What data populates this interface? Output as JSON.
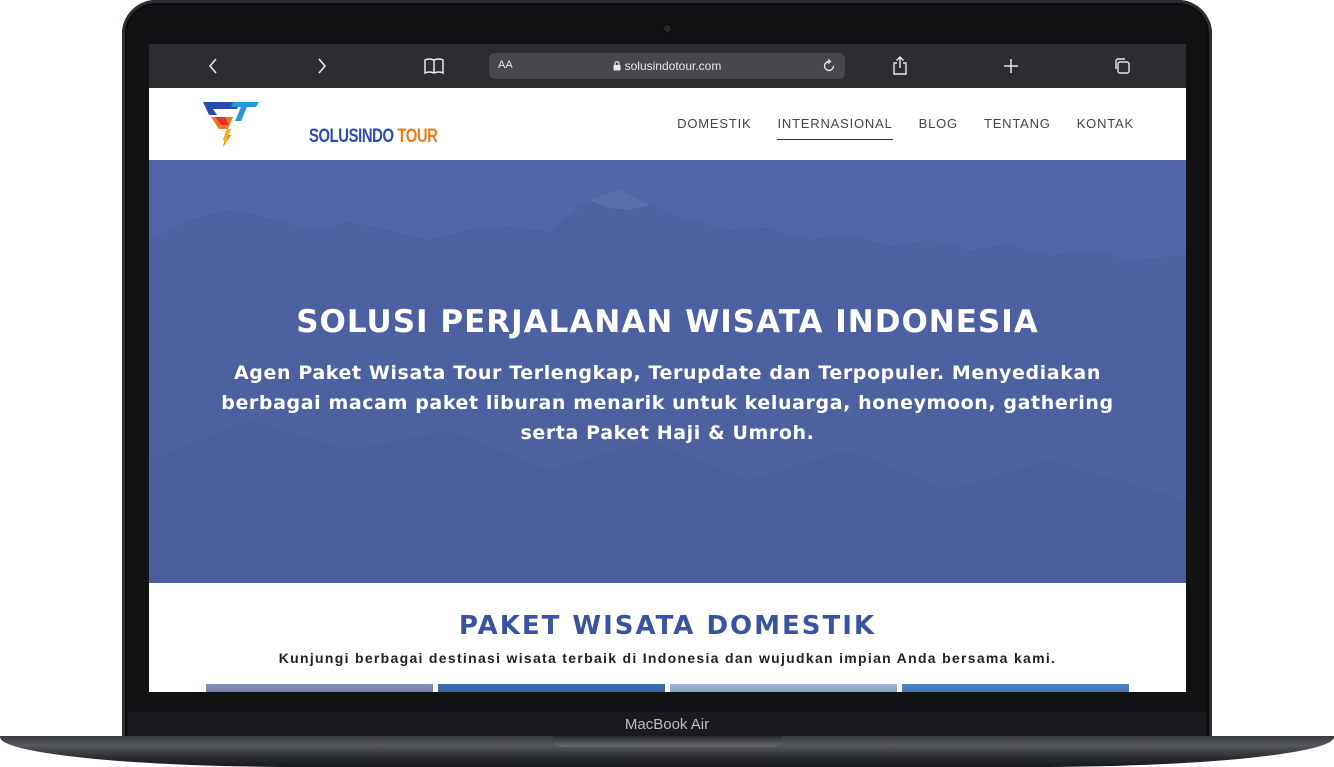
{
  "device": {
    "label": "MacBook Air"
  },
  "browser": {
    "text_size_label": "AA",
    "url": "solusindotour.com",
    "icons": [
      "chevron-left-icon",
      "chevron-right-icon",
      "book-icon",
      "lock-icon",
      "reload-icon",
      "share-icon",
      "plus-icon",
      "tabs-icon"
    ]
  },
  "site": {
    "logo": {
      "text_a": "SOLUSINDO",
      "text_b": "TOUR"
    },
    "nav": [
      {
        "label": "DOMESTIK"
      },
      {
        "label": "INTERNASIONAL",
        "active": true
      },
      {
        "label": "BLOG"
      },
      {
        "label": "TENTANG"
      },
      {
        "label": "KONTAK"
      }
    ],
    "hero": {
      "title": "SOLUSI PERJALANAN WISATA INDONESIA",
      "subtitle": "Agen Paket Wisata Tour Terlengkap, Terupdate dan Terpopuler.  Menyediakan berbagai macam paket liburan menarik untuk keluarga, honeymoon, gathering serta Paket Haji & Umroh."
    },
    "section": {
      "title": "PAKET WISATA DOMESTIK",
      "subtitle": "Kunjungi berbagai destinasi wisata terbaik di Indonesia dan wujudkan impian Anda bersama kami."
    }
  },
  "colors": {
    "hero_overlay": "#5165a8",
    "brand_blue": "#3a53a0",
    "brand_orange": "#f07a1a",
    "toolbar_bg": "#2b2d31"
  }
}
